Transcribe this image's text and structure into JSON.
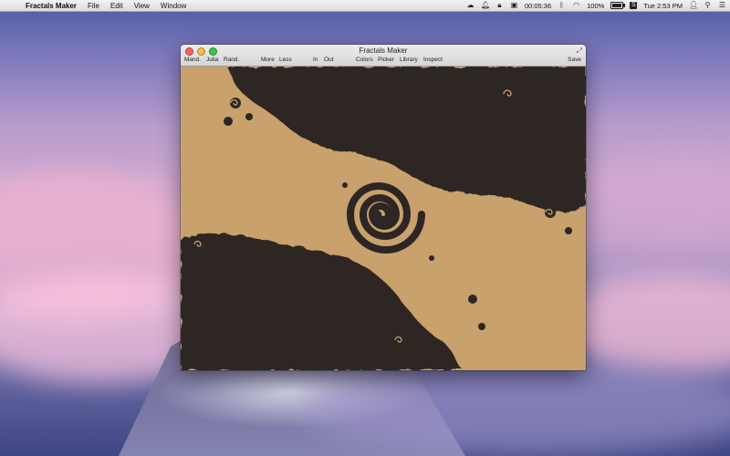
{
  "menubar": {
    "apple_icon": "apple-icon",
    "app_name": "Fractals Maker",
    "menus": [
      "File",
      "Edit",
      "View",
      "Window"
    ],
    "timer": "00:05:36",
    "battery_percent": "100%",
    "clock": "Tue 2:53 PM",
    "status_icons": [
      "cloud-icon",
      "bell-icon",
      "lock-icon",
      "timer-icon",
      "bluetooth-icon",
      "wifi-icon",
      "battery-icon",
      "s-app-icon",
      "user-icon",
      "spotlight-icon",
      "notifications-icon"
    ]
  },
  "window": {
    "title": "Fractals Maker",
    "toolbar": {
      "mandelbrot": "Mand.",
      "julia": "Julia",
      "random": "Rand.",
      "more": "More",
      "less": "Less",
      "zoom_in": "In",
      "zoom_out": "Out",
      "colors": "Colors",
      "picker": "Picker",
      "library": "Library",
      "inspect": "Inspect",
      "save": "Save"
    }
  },
  "fractal": {
    "type": "Julia set spiral",
    "colors": {
      "light": "#c8a16c",
      "dark": "#2e2624"
    }
  }
}
